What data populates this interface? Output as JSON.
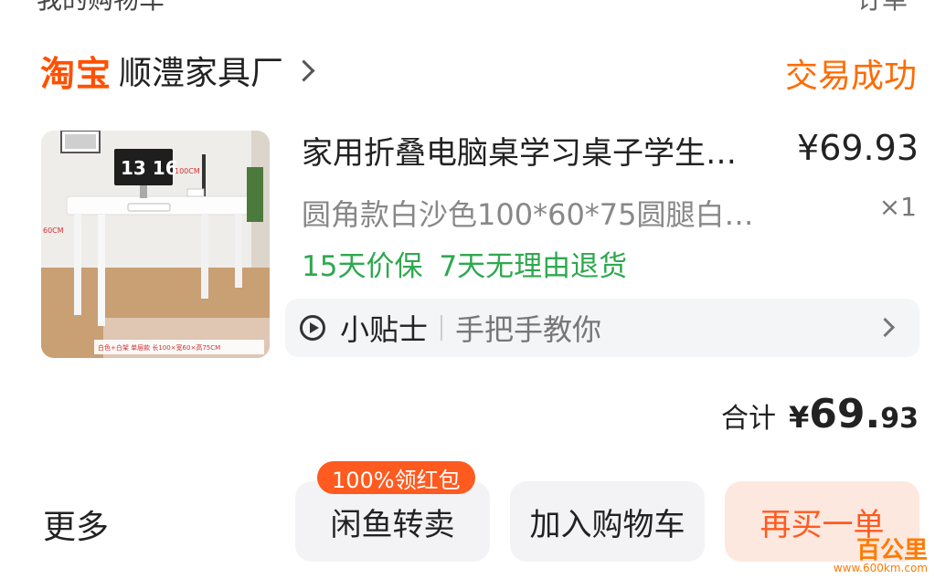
{
  "top_cut": {
    "left": "我的购物车",
    "right": "订单"
  },
  "shop": {
    "platform": "淘宝",
    "name": "顺澧家具厂",
    "status": "交易成功"
  },
  "item": {
    "thumbnail_overlay": {
      "clock": "13 16",
      "dim_width": "100CM",
      "dim_depth": "60CM",
      "caption": "白色+白架 单层款  长100×宽60×高75CM"
    },
    "title": "家用折叠电脑桌学习桌子学生…",
    "price": "¥69.93",
    "spec": "圆角款白沙色100*60*75圆腿白…",
    "qty": "×1",
    "badges": [
      "15天价保",
      "7天无理由退货"
    ]
  },
  "tips": {
    "title": "小贴士",
    "subtitle": "手把手教你"
  },
  "total": {
    "label": "合计",
    "currency": "¥",
    "integer": "69",
    "dot": ".",
    "decimal": "93"
  },
  "actions": {
    "more": "更多",
    "xianyu": "闲鱼转卖",
    "redpack_badge": "100%领红包",
    "cart": "加入购物车",
    "rebuy": "再买一单"
  },
  "watermark": {
    "brand": "百公里",
    "url": "www.600km.com"
  },
  "colors": {
    "accent": "#ff5000",
    "green": "#2fa84f",
    "status": "#ff6a00"
  }
}
